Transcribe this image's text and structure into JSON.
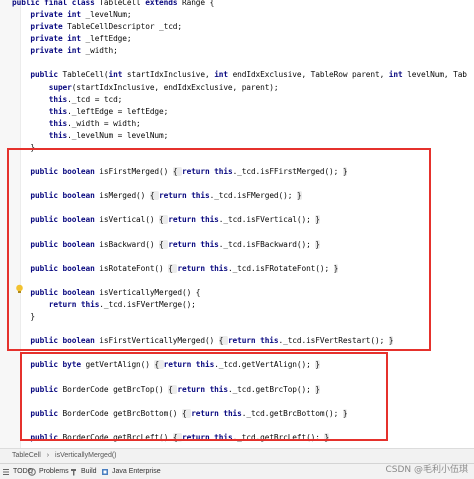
{
  "lines": [
    [
      {
        "t": "public final class ",
        "k": "kw"
      },
      {
        "t": "TableCell ",
        "k": ""
      },
      {
        "t": "extends ",
        "k": "kw"
      },
      {
        "t": "Range {",
        "k": ""
      }
    ],
    [
      {
        "t": "    private int ",
        "k": "kw"
      },
      {
        "t": "_levelNum;",
        "k": ""
      }
    ],
    [
      {
        "t": "    private ",
        "k": "kw"
      },
      {
        "t": "TableCellDescriptor _tcd;",
        "k": ""
      }
    ],
    [
      {
        "t": "    private int ",
        "k": "kw"
      },
      {
        "t": "_leftEdge;",
        "k": ""
      }
    ],
    [
      {
        "t": "    private int ",
        "k": "kw"
      },
      {
        "t": "_width;",
        "k": ""
      }
    ],
    [],
    [
      {
        "t": "    public ",
        "k": "kw"
      },
      {
        "t": "TableCell(",
        "k": ""
      },
      {
        "t": "int ",
        "k": "kw"
      },
      {
        "t": "startIdxInclusive, ",
        "k": ""
      },
      {
        "t": "int ",
        "k": "kw"
      },
      {
        "t": "endIdxExclusive, TableRow parent, ",
        "k": ""
      },
      {
        "t": "int ",
        "k": "kw"
      },
      {
        "t": "levelNum, Tab",
        "k": ""
      }
    ],
    [
      {
        "t": "        super",
        "k": "kw"
      },
      {
        "t": "(startIdxInclusive, endIdxExclusive, parent);",
        "k": ""
      }
    ],
    [
      {
        "t": "        this",
        "k": "kw"
      },
      {
        "t": "._tcd = tcd;",
        "k": ""
      }
    ],
    [
      {
        "t": "        this",
        "k": "kw"
      },
      {
        "t": "._leftEdge = leftEdge;",
        "k": ""
      }
    ],
    [
      {
        "t": "        this",
        "k": "kw"
      },
      {
        "t": "._width = width;",
        "k": ""
      }
    ],
    [
      {
        "t": "        this",
        "k": "kw"
      },
      {
        "t": "._levelNum = levelNum;",
        "k": ""
      }
    ],
    [
      {
        "t": "    }",
        "k": ""
      }
    ],
    [],
    [
      {
        "t": "    public boolean ",
        "k": "kw"
      },
      {
        "t": "isFirstMerged() ",
        "k": ""
      },
      {
        "t": "{ ",
        "k": "hl"
      },
      {
        "t": "return this",
        "k": "kw"
      },
      {
        "t": "._tcd.isFFirstMerged(); ",
        "k": ""
      },
      {
        "t": "}",
        "k": "hl"
      }
    ],
    [],
    [
      {
        "t": "    public boolean ",
        "k": "kw"
      },
      {
        "t": "isMerged() ",
        "k": ""
      },
      {
        "t": "{ ",
        "k": "hl"
      },
      {
        "t": "return this",
        "k": "kw"
      },
      {
        "t": "._tcd.isFMerged(); ",
        "k": ""
      },
      {
        "t": "}",
        "k": "hl"
      }
    ],
    [],
    [
      {
        "t": "    public boolean ",
        "k": "kw"
      },
      {
        "t": "isVertical() ",
        "k": ""
      },
      {
        "t": "{ ",
        "k": "hl"
      },
      {
        "t": "return this",
        "k": "kw"
      },
      {
        "t": "._tcd.isFVertical(); ",
        "k": ""
      },
      {
        "t": "}",
        "k": "hl"
      }
    ],
    [],
    [
      {
        "t": "    public boolean ",
        "k": "kw"
      },
      {
        "t": "isBackward() ",
        "k": ""
      },
      {
        "t": "{ ",
        "k": "hl"
      },
      {
        "t": "return this",
        "k": "kw"
      },
      {
        "t": "._tcd.isFBackward(); ",
        "k": ""
      },
      {
        "t": "}",
        "k": "hl"
      }
    ],
    [],
    [
      {
        "t": "    public boolean ",
        "k": "kw"
      },
      {
        "t": "isRotateFont() ",
        "k": ""
      },
      {
        "t": "{ ",
        "k": "hl"
      },
      {
        "t": "return this",
        "k": "kw"
      },
      {
        "t": "._tcd.isFRotateFont(); ",
        "k": ""
      },
      {
        "t": "}",
        "k": "hl"
      }
    ],
    [],
    [
      {
        "t": "    public boolean ",
        "k": "kw"
      },
      {
        "t": "isVerticallyMerged() {",
        "k": ""
      }
    ],
    [
      {
        "t": "        return this",
        "k": "kw"
      },
      {
        "t": "._tcd.isFVertMerge();",
        "k": ""
      }
    ],
    [
      {
        "t": "    }",
        "k": ""
      }
    ],
    [],
    [
      {
        "t": "    public boolean ",
        "k": "kw"
      },
      {
        "t": "isFirstVerticallyMerged() ",
        "k": ""
      },
      {
        "t": "{ ",
        "k": "hl"
      },
      {
        "t": "return this",
        "k": "kw"
      },
      {
        "t": "._tcd.isFVertRestart(); ",
        "k": ""
      },
      {
        "t": "}",
        "k": "hl"
      }
    ],
    [],
    [
      {
        "t": "    public byte ",
        "k": "kw"
      },
      {
        "t": "getVertAlign() ",
        "k": ""
      },
      {
        "t": "{ ",
        "k": "hl"
      },
      {
        "t": "return this",
        "k": "kw"
      },
      {
        "t": "._tcd.getVertAlign(); ",
        "k": ""
      },
      {
        "t": "}",
        "k": "hl"
      }
    ],
    [],
    [
      {
        "t": "    public ",
        "k": "kw"
      },
      {
        "t": "BorderCode getBrcTop() ",
        "k": ""
      },
      {
        "t": "{ ",
        "k": "hl"
      },
      {
        "t": "return this",
        "k": "kw"
      },
      {
        "t": "._tcd.getBrcTop(); ",
        "k": ""
      },
      {
        "t": "}",
        "k": "hl"
      }
    ],
    [],
    [
      {
        "t": "    public ",
        "k": "kw"
      },
      {
        "t": "BorderCode getBrcBottom() ",
        "k": ""
      },
      {
        "t": "{ ",
        "k": "hl"
      },
      {
        "t": "return this",
        "k": "kw"
      },
      {
        "t": "._tcd.getBrcBottom(); ",
        "k": ""
      },
      {
        "t": "}",
        "k": "hl"
      }
    ],
    [],
    [
      {
        "t": "    public ",
        "k": "kw"
      },
      {
        "t": "BorderCode getBrcLeft() ",
        "k": ""
      },
      {
        "t": "{ ",
        "k": "hl"
      },
      {
        "t": "return this",
        "k": "kw"
      },
      {
        "t": "._tcd.getBrcLeft(); ",
        "k": ""
      },
      {
        "t": "}",
        "k": "hl"
      }
    ]
  ],
  "breadcrumb": {
    "class_name": "TableCell",
    "separator": "›",
    "method_name": "isVerticallyMerged()"
  },
  "toolbar": {
    "todo": "TODO",
    "problems": "Problems",
    "build": "Build",
    "java_enterprise": "Java Enterprise"
  },
  "watermark": "CSDN @毛利小伍琪",
  "colors": {
    "highlight_box": "#e5312c",
    "keyword": "#0a0a80",
    "editor_bg": "#ffffff"
  },
  "icons": {
    "gutter_marker": "lightbulb-icon"
  }
}
